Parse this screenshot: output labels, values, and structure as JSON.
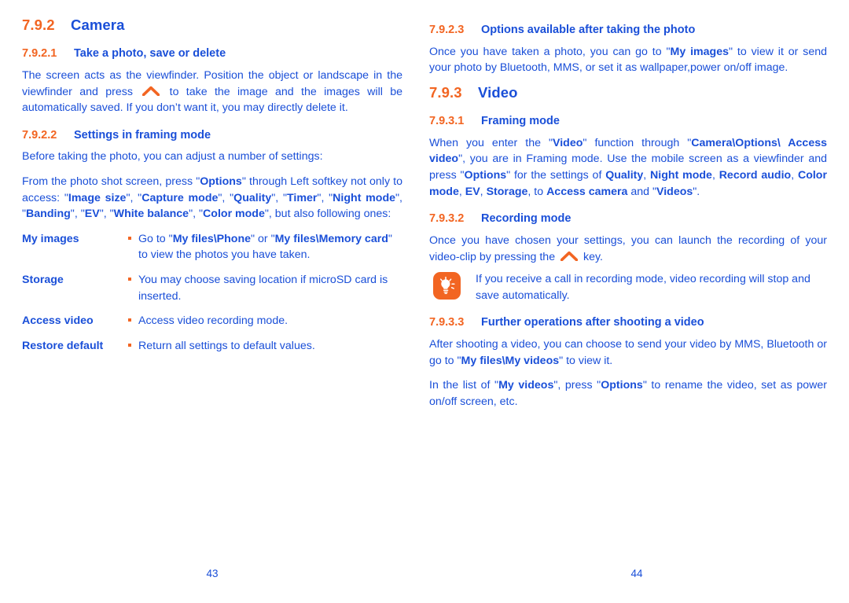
{
  "document": {
    "title": "Camera and Video user guide page",
    "text_color": "#1a4fd8",
    "accent_color": "#f26522"
  },
  "left_column": {
    "section": {
      "number": "7.9.2",
      "title": "Camera"
    },
    "sub1": {
      "number": "7.9.2.1",
      "title": "Take a photo, save or delete",
      "paragraph_part1": "The screen acts as the viewfinder. Position the object or landscape in the viewfinder and press ",
      "key_icon": "camera-key-chevron-icon",
      "paragraph_part2": " to take the image and the images will be automatically saved. If you don’t want it, you may directly delete it."
    },
    "sub2": {
      "number": "7.9.2.2",
      "title": "Settings in framing mode",
      "intro": "Before taking the photo, you can adjust a number of settings:",
      "access_para": {
        "t1": "From the photo shot screen, press \"",
        "b1": "Options",
        "t2": "\" through Left softkey not only to access: \"",
        "b2": "Image size",
        "t3": "\", \"",
        "b3": "Capture mode",
        "t4": "\", \"",
        "b4": "Quality",
        "t5": "\", \"",
        "b5": "Timer",
        "t6": "\", \"",
        "b6": "Night mode",
        "t7": "\", \"",
        "b7": "Banding",
        "t8": "\", \"",
        "b8": "EV",
        "t9": "\", \"",
        "b9": "White balance",
        "t10": "\", \"",
        "b10": "Color mode",
        "t11": "\", but also following ones:"
      },
      "settings": [
        {
          "term": "My images",
          "desc_t1": "Go to \"",
          "desc_b1": "My files\\Phone",
          "desc_t2": "\" or \"",
          "desc_b2": "My files\\Memory card",
          "desc_t3": "\" to view the photos you have taken."
        },
        {
          "term": "Storage",
          "desc_t1": "You may choose saving location if microSD card is inserted.",
          "desc_b1": "",
          "desc_t2": "",
          "desc_b2": "",
          "desc_t3": ""
        },
        {
          "term": "Access video",
          "desc_t1": "Access video recording mode.",
          "desc_b1": "",
          "desc_t2": "",
          "desc_b2": "",
          "desc_t3": ""
        },
        {
          "term": "Restore default",
          "desc_t1": "Return all settings to default values.",
          "desc_b1": "",
          "desc_t2": "",
          "desc_b2": "",
          "desc_t3": ""
        }
      ]
    },
    "page_number": "43"
  },
  "right_column": {
    "sub3": {
      "number": "7.9.2.3",
      "title": "Options available after taking the photo",
      "t1": "Once you have taken a photo, you can go to \"",
      "b1": "My images",
      "t2": "\" to view it or send your photo by Bluetooth, MMS, or set it as wallpaper,power on/off image."
    },
    "section": {
      "number": "7.9.3",
      "title": "Video"
    },
    "sub31": {
      "number": "7.9.3.1",
      "title": "Framing mode",
      "t1": "When you enter the \"",
      "b1": "Video",
      "t2": "\" function through \"",
      "b2": "Camera\\Options\\ Access video",
      "t3": "\", you are in Framing mode. Use the mobile screen as a viewfinder and press \"",
      "b3": "Options",
      "t4": "\" for the settings of ",
      "b4": "Quality",
      "t5": ", ",
      "b5": "Night mode",
      "t6": ", ",
      "b6": "Record audio",
      "t7": ", ",
      "b7": "Color mode",
      "t8": ", ",
      "b8": "EV",
      "t9": ", ",
      "b9": "Storage",
      "t10": ", to ",
      "b10": "Access camera",
      "t11": " and \"",
      "b11": "Videos",
      "t12": "\"."
    },
    "sub32": {
      "number": "7.9.3.2",
      "title": "Recording mode",
      "t1": "Once you have chosen your settings, you can launch the recording of your video-clip by pressing the ",
      "key_icon": "camera-key-chevron-icon",
      "t2": " key.",
      "tip": {
        "icon": "lightbulb-tip-icon",
        "text": "If you receive a call in recording mode, video recording will stop and save automatically."
      }
    },
    "sub33": {
      "number": "7.9.3.3",
      "title": "Further operations after shooting a video",
      "p1_t1": "After shooting a video, you can choose to send your video by MMS, Bluetooth or go to \"",
      "p1_b1": "My files\\My videos",
      "p1_t2": "\" to view it.",
      "p2_t1": "In the list of \"",
      "p2_b1": "My videos",
      "p2_t2": "\", press \"",
      "p2_b2": "Options",
      "p2_t3": "\" to rename the video, set as power on/off screen, etc."
    },
    "page_number": "44"
  }
}
